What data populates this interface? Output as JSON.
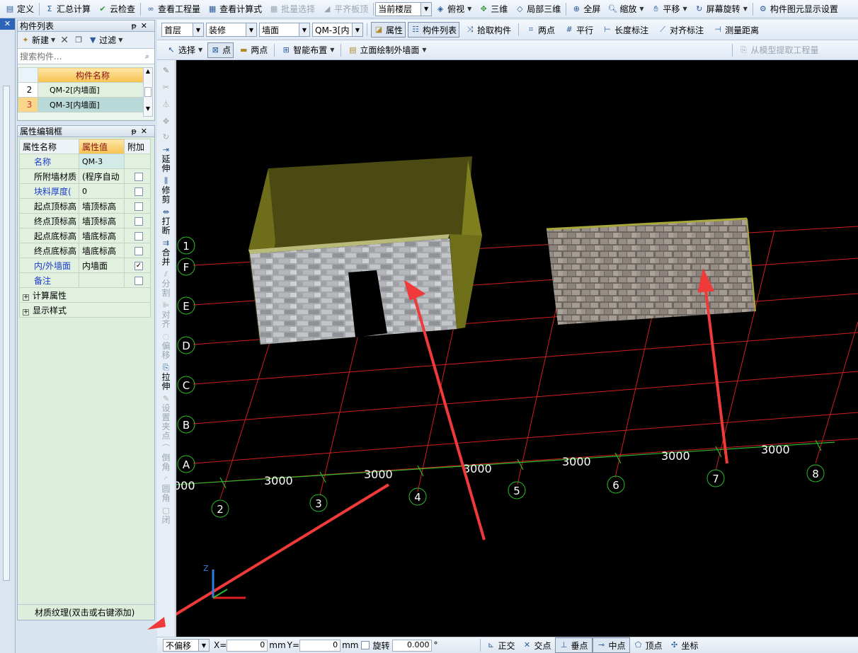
{
  "toolbar1": {
    "items": [
      "定义",
      "汇总计算",
      "云检查",
      "查看工程量",
      "查看计算式",
      "批量选择",
      "平齐板顶"
    ],
    "floor_combo": "当前楼层",
    "view_items": [
      "俯视",
      "三维",
      "局部三维",
      "全屏",
      "缩放",
      "平移",
      "屏幕旋转",
      "构件图元显示设置"
    ]
  },
  "toolbar2": {
    "floor": "首层",
    "category": "装修",
    "type": "墙面",
    "component": "QM-3[内",
    "btn_props": "属性",
    "btn_list": "构件列表",
    "pick": "拾取构件",
    "tools": [
      "两点",
      "平行",
      "长度标注",
      "对齐标注",
      "测量距离"
    ]
  },
  "toolbar3": {
    "select": "选择",
    "point": "点",
    "twopoint": "两点",
    "smart": "智能布置",
    "elevation": "立面绘制外墙面",
    "extract": "从模型提取工程量"
  },
  "comp_list": {
    "title": "构件列表",
    "new": "新建",
    "filter": "过滤",
    "search_placeholder": "搜索构件...",
    "header": "构件名称",
    "rows": [
      {
        "no": "2",
        "name": "QM-2[内墙面]"
      },
      {
        "no": "3",
        "name": "QM-3[内墙面]"
      }
    ]
  },
  "prop_editor": {
    "title": "属性编辑框",
    "headers": [
      "属性名称",
      "属性值",
      "附加"
    ],
    "rows": [
      {
        "name": "名称",
        "value": "QM-3"
      },
      {
        "name": "所附墙材质",
        "value": "(程序自动"
      },
      {
        "name": "块料厚度(",
        "value": "0"
      },
      {
        "name": "起点顶标高",
        "value": "墙顶标高"
      },
      {
        "name": "终点顶标高",
        "value": "墙顶标高"
      },
      {
        "name": "起点底标高",
        "value": "墙底标高"
      },
      {
        "name": "终点底标高",
        "value": "墙底标高"
      },
      {
        "name": "内/外墙面",
        "value": "内墙面"
      },
      {
        "name": "备注",
        "value": ""
      }
    ],
    "groups": [
      "计算属性",
      "显示样式"
    ],
    "texture": "材质纹理(双击或右键添加)"
  },
  "vertical_tools": [
    "延伸",
    "修剪",
    "打断",
    "合并",
    "分割",
    "对齐",
    "偏移",
    "拉伸",
    "设置夹点",
    "倒角",
    "圆角",
    "闭"
  ],
  "axes": {
    "rows": [
      "1",
      "F",
      "E",
      "D",
      "C",
      "B",
      "A"
    ],
    "cols": [
      "2",
      "3",
      "4",
      "5",
      "6",
      "7",
      "8"
    ],
    "dims": [
      "000",
      "3000",
      "3000",
      "3000",
      "3000",
      "3000",
      "3000"
    ]
  },
  "status": {
    "mode": "不偏移",
    "x_label": "X=",
    "x": "0",
    "y_label": "Y=",
    "y": "0",
    "unit": "mm",
    "rotate": "旋转",
    "angle": "0.000",
    "degree": "°",
    "snaps": [
      "正交",
      "交点",
      "垂点",
      "中点",
      "顶点",
      "坐标"
    ]
  }
}
